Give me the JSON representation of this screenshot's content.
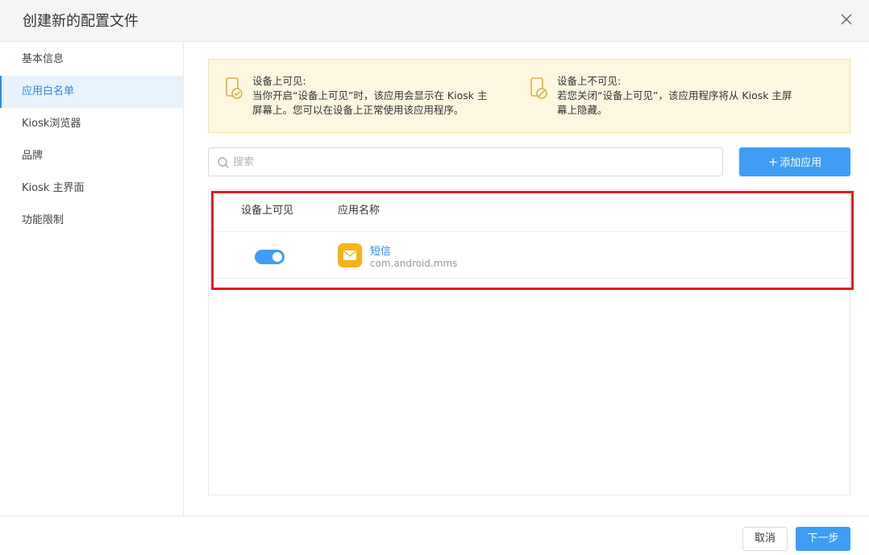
{
  "dialog": {
    "title": "创建新的配置文件"
  },
  "sidebar": {
    "items": [
      {
        "label": "基本信息",
        "active": false
      },
      {
        "label": "应用白名单",
        "active": true
      },
      {
        "label": "Kiosk浏览器",
        "active": false
      },
      {
        "label": "品牌",
        "active": false
      },
      {
        "label": "Kiosk 主界面",
        "active": false
      },
      {
        "label": "功能限制",
        "active": false
      }
    ]
  },
  "notice": {
    "visible": {
      "line1": "设备上可见:",
      "line2": "当你开启“设备上可见”时，该应用会显示在 Kiosk 主",
      "line3": "屏幕上。您可以在设备上正常使用该应用程序。"
    },
    "invisible": {
      "line1": "设备上不可见:",
      "line2": "若您关闭“设备上可见”，该应用程序将从 Kiosk 主屏",
      "line3": "幕上隐藏。"
    }
  },
  "search": {
    "placeholder": "搜索",
    "value": ""
  },
  "toolbar": {
    "add_label": "添加应用",
    "add_plus": "+"
  },
  "table": {
    "headers": {
      "visible": "设备上可见",
      "app_name": "应用名称"
    },
    "rows": [
      {
        "visible_on_device": true,
        "name": "短信",
        "package": "com.android.mms",
        "icon": "message-icon"
      }
    ]
  },
  "footer": {
    "cancel_label": "取消",
    "next_label": "下一步"
  },
  "colors": {
    "accent": "#3f9df5",
    "link": "#2d8ae6",
    "highlight": "#e31b23",
    "notice_bg": "#fdf7e0",
    "icon_amber": "#f6b21a"
  }
}
